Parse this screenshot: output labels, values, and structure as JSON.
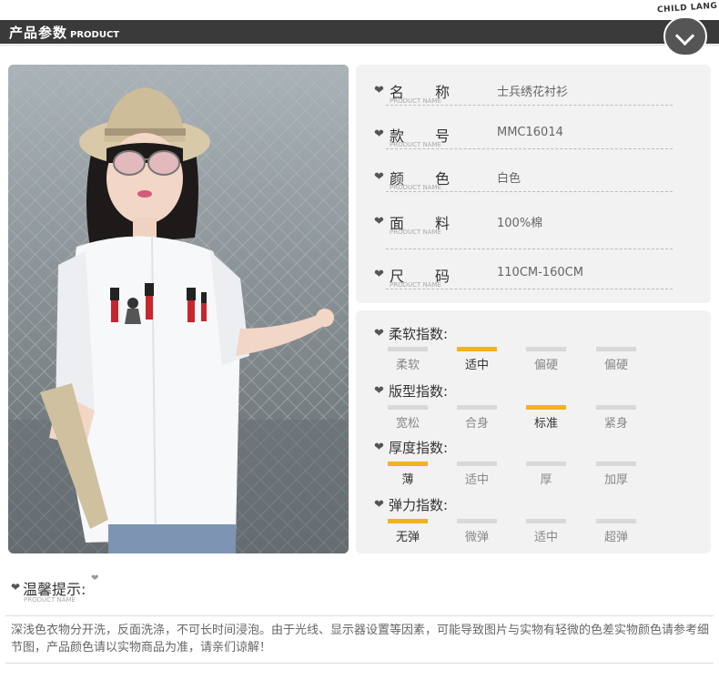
{
  "header": {
    "title": "产品参数",
    "title_en": "PRODUCT",
    "brand": "CHILD LANG"
  },
  "info_rows": [
    {
      "label": "名称",
      "label_en": "PRODUCT NAME",
      "value": "士兵绣花衬衫"
    },
    {
      "label": "款号",
      "label_en": "PRODUCT NAME",
      "value": "MMC16014"
    },
    {
      "label": "颜色",
      "label_en": "PRODUCT NAME",
      "value": "白色"
    },
    {
      "label": "面料",
      "label_en": "PRODUCT NAME",
      "value": "100%棉"
    },
    {
      "label": "尺码",
      "label_en": "PRODUCT NAME",
      "value": "110CM-160CM"
    }
  ],
  "indices": [
    {
      "title": "柔软指数:",
      "options": [
        "柔软",
        "适中",
        "偏硬",
        "偏硬"
      ],
      "selected": 1
    },
    {
      "title": "版型指数:",
      "options": [
        "宽松",
        "合身",
        "标准",
        "紧身"
      ],
      "selected": 2
    },
    {
      "title": "厚度指数:",
      "options": [
        "薄",
        "适中",
        "厚",
        "加厚"
      ],
      "selected": 0
    },
    {
      "title": "弹力指数:",
      "options": [
        "无弹",
        "微弹",
        "适中",
        "超弹"
      ],
      "selected": 0
    }
  ],
  "tips": {
    "title": "温馨提示:",
    "title_en": "PRODUCT NAME",
    "body": "深浅色衣物分开洗，反面洗涤，不可长时间浸泡。由于光线、显示器设置等因素，可能导致图片与实物有轻微的色差实物颜色请参考细节图，产品颜色请以实物商品为准，请亲们谅解！"
  },
  "colors": {
    "header_bg": "#3a3a3a",
    "panel_bg": "#f2f2f2",
    "accent": "#f0b323",
    "bar_off": "#d9d9d9"
  },
  "icons": {
    "bullet": "heart-icon",
    "badge": "chevron-down-icon"
  }
}
